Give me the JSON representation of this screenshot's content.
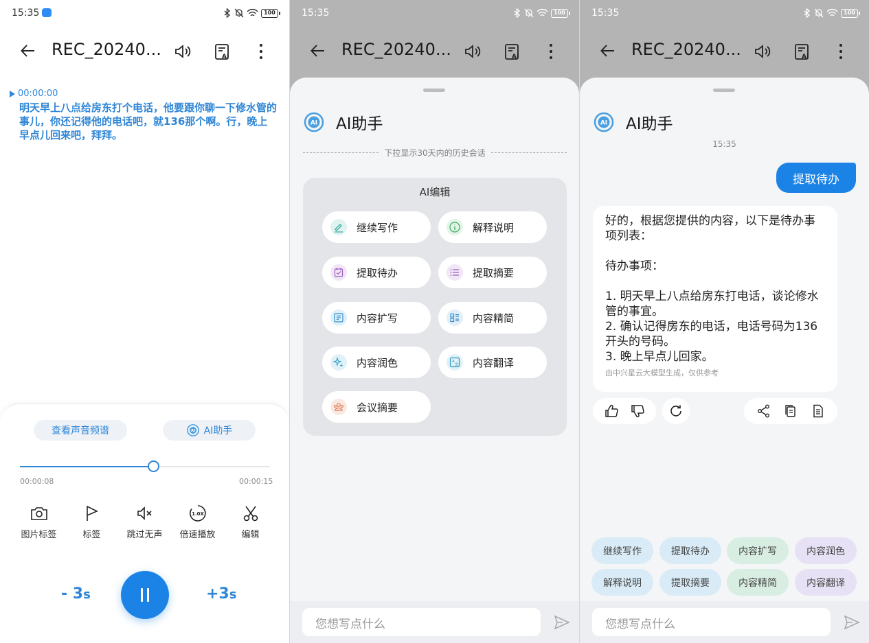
{
  "status_bar": {
    "time": "15:35",
    "battery": "100"
  },
  "header": {
    "title": "REC_20240..."
  },
  "panel1": {
    "transcript": {
      "timestamp": "00:00:00",
      "text": "明天早上八点给房东打个电话，他要跟你聊一下修水管的事儿，你还记得他的电话吧，就136那个啊。行，晚上早点儿回来吧，拜拜。"
    },
    "chips": {
      "spectrum": "查看声音频谱",
      "ai_assistant": "AI助手"
    },
    "progress": {
      "current": "00:00:08",
      "total": "00:00:15",
      "fraction": 0.533
    },
    "tools": [
      "图片标签",
      "标签",
      "跳过无声",
      "倍速播放",
      "编辑"
    ],
    "speed_badge": "1.0X",
    "skip_back": {
      "num": "- 3",
      "unit": "s"
    },
    "skip_forward": {
      "num": "+3",
      "unit": "s"
    }
  },
  "assistant": {
    "name": "AI助手",
    "history_hint": "下拉显示30天内的历史会话",
    "edit_title": "AI编辑",
    "buttons": [
      "继续写作",
      "解释说明",
      "提取待办",
      "提取摘要",
      "内容扩写",
      "内容精简",
      "内容润色",
      "内容翻译",
      "会议摘要"
    ],
    "input_placeholder": "您想写点什么"
  },
  "chat": {
    "time": "15:35",
    "user_message": "提取待办",
    "reply": {
      "intro": "好的，根据您提供的内容，以下是待办事项列表：",
      "heading": "待办事项：",
      "items": [
        "1. 明天早上八点给房东打电话，谈论修水管的事宜。",
        "2. 确认记得房东的电话，电话号码为136开头的号码。",
        "3. 晚上早点儿回家。"
      ],
      "note": "由中兴星云大模型生成，仅供参考"
    },
    "suggestions": [
      "继续写作",
      "提取待办",
      "内容扩写",
      "内容润色",
      "解释说明",
      "提取摘要",
      "内容精简",
      "内容翻译"
    ]
  },
  "colors": {
    "accent": "#1b82e6",
    "text_blue": "#2f86d6",
    "sheet_bg": "#f4f5f7",
    "dim_bg": "#b4b4b4"
  }
}
